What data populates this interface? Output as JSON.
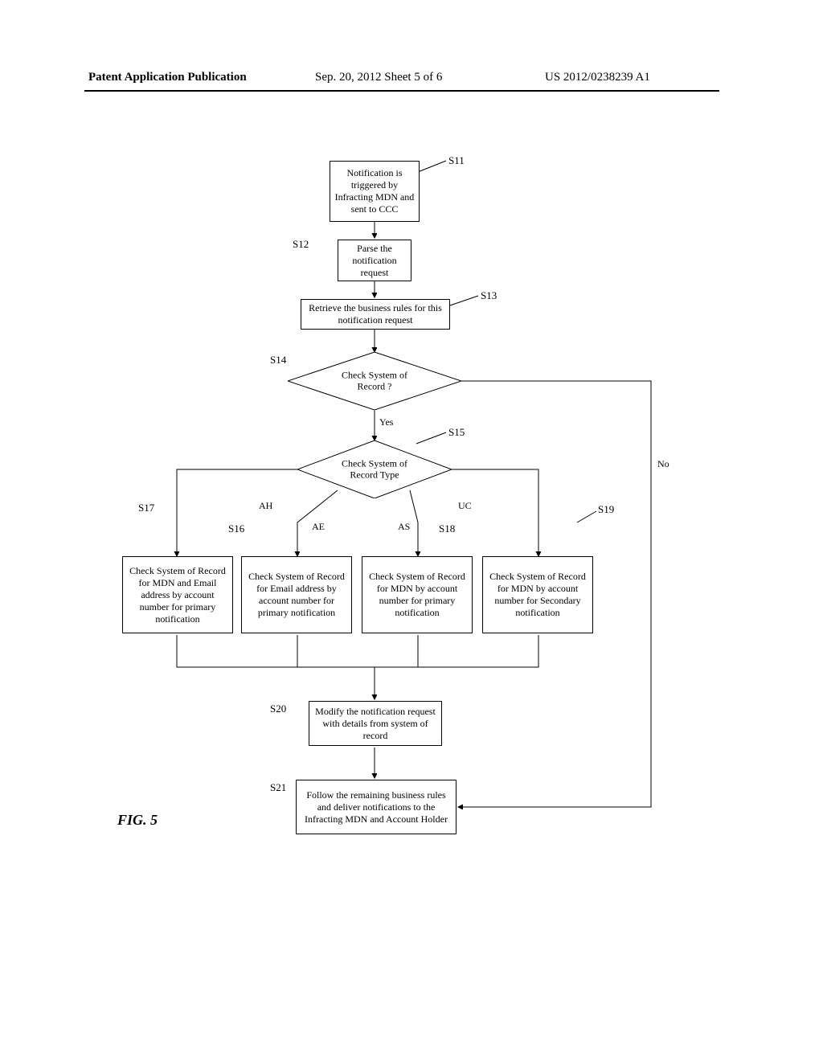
{
  "header": {
    "left": "Patent Application Publication",
    "center": "Sep. 20, 2012   Sheet 5 of 6",
    "right": "US 2012/0238239 A1"
  },
  "figure_label": "FIG. 5",
  "steps": {
    "s11": {
      "label": "S11",
      "text": "Notification is triggered by Infracting MDN and sent to CCC"
    },
    "s12": {
      "label": "S12",
      "text": "Parse the notification request"
    },
    "s13": {
      "label": "S13",
      "text": "Retrieve the business rules for this notification request"
    },
    "s14": {
      "label": "S14",
      "text": "Check System of Record ?"
    },
    "s15": {
      "label": "S15",
      "text": "Check System of Record Type"
    },
    "s16": {
      "label": "S16",
      "text": "Check System of Record for Email address by account number for primary notification"
    },
    "s17": {
      "label": "S17",
      "text": "Check System of Record for MDN and Email address by account number for primary notification"
    },
    "s18": {
      "label": "S18",
      "text": "Check System of Record for MDN by account number for primary notification"
    },
    "s19": {
      "label": "S19",
      "text": "Check System of Record for MDN by account number for Secondary notification"
    },
    "s20": {
      "label": "S20",
      "text": "Modify the notification request with details from system of record"
    },
    "s21": {
      "label": "S21",
      "text": "Follow the remaining business rules and deliver notifications to the Infracting MDN and Account Holder"
    }
  },
  "branches": {
    "yes": "Yes",
    "no": "No",
    "ah": "AH",
    "ae": "AE",
    "as": "AS",
    "uc": "UC"
  },
  "chart_data": {
    "type": "flowchart",
    "title": "FIG. 5",
    "nodes": [
      {
        "id": "S11",
        "type": "process",
        "text": "Notification is triggered by Infracting MDN and sent to CCC"
      },
      {
        "id": "S12",
        "type": "process",
        "text": "Parse the notification request"
      },
      {
        "id": "S13",
        "type": "process",
        "text": "Retrieve the business rules for this notification request"
      },
      {
        "id": "S14",
        "type": "decision",
        "text": "Check System of Record ?"
      },
      {
        "id": "S15",
        "type": "decision",
        "text": "Check System of Record Type"
      },
      {
        "id": "S16",
        "type": "process",
        "text": "Check System of Record for Email address by account number for primary notification"
      },
      {
        "id": "S17",
        "type": "process",
        "text": "Check System of Record for MDN and Email address by account number for primary notification"
      },
      {
        "id": "S18",
        "type": "process",
        "text": "Check System of Record for MDN by account number for primary notification"
      },
      {
        "id": "S19",
        "type": "process",
        "text": "Check System of Record for MDN by account number for Secondary notification"
      },
      {
        "id": "S20",
        "type": "process",
        "text": "Modify the notification request with details from system of record"
      },
      {
        "id": "S21",
        "type": "process",
        "text": "Follow the remaining business rules and deliver notifications to the Infracting MDN and Account Holder"
      }
    ],
    "edges": [
      {
        "from": "S11",
        "to": "S12"
      },
      {
        "from": "S12",
        "to": "S13"
      },
      {
        "from": "S13",
        "to": "S14"
      },
      {
        "from": "S14",
        "to": "S15",
        "label": "Yes"
      },
      {
        "from": "S14",
        "to": "S21",
        "label": "No"
      },
      {
        "from": "S15",
        "to": "S17",
        "label": "AH"
      },
      {
        "from": "S15",
        "to": "S16",
        "label": "AE"
      },
      {
        "from": "S15",
        "to": "S18",
        "label": "AS"
      },
      {
        "from": "S15",
        "to": "S19",
        "label": "UC"
      },
      {
        "from": "S16",
        "to": "S20"
      },
      {
        "from": "S17",
        "to": "S20"
      },
      {
        "from": "S18",
        "to": "S20"
      },
      {
        "from": "S19",
        "to": "S20"
      },
      {
        "from": "S20",
        "to": "S21"
      }
    ]
  }
}
